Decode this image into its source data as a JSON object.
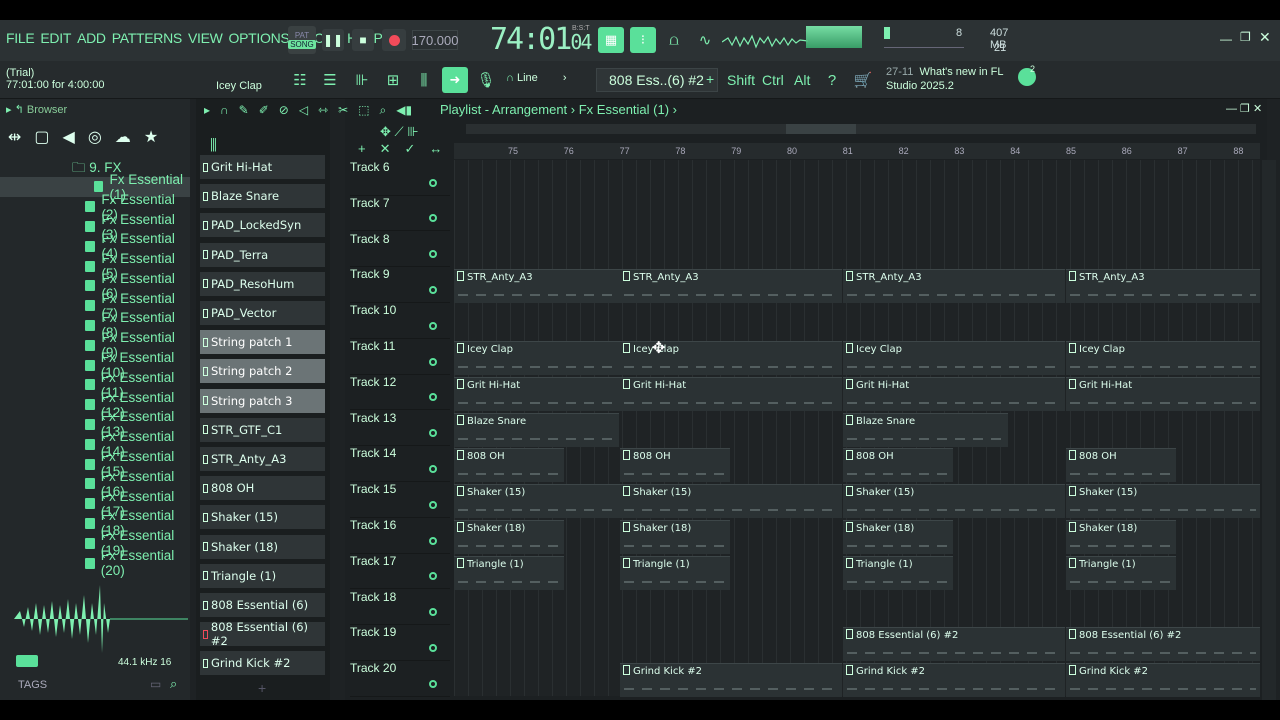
{
  "menu": [
    "FILE",
    "EDIT",
    "ADD",
    "PATTERNS",
    "VIEW",
    "OPTIONS",
    "TOOLS",
    "HELP"
  ],
  "transport": {
    "pat_label": "PAT",
    "song_label": "SONG",
    "tempo": "170.000",
    "time_main": "74:01",
    "time_sub": "04",
    "time_unit": "B:S:T"
  },
  "meters": {
    "voices": "8",
    "memory": "407 MB",
    "cpu": "21"
  },
  "hint": {
    "line1": "(Trial)",
    "line2": "77:01:00 for 4:00:00",
    "channel": "Icey Clap"
  },
  "toolbar": {
    "snap": "Line",
    "pattern": "808 Ess..(6) #2",
    "shift": "Shift",
    "ctrl": "Ctrl",
    "alt": "Alt"
  },
  "news": {
    "date": "27-11",
    "text1": "What's new in FL",
    "text2": "Studio 2025.2",
    "count": "2"
  },
  "browser": {
    "title": "Browser",
    "folder": "9. FX",
    "items": [
      "Fx Essential (1)",
      "Fx Essential (2)",
      "Fx Essential (3)",
      "Fx Essential (4)",
      "Fx Essential (5)",
      "Fx Essential (6)",
      "Fx Essential (7)",
      "Fx Essential (8)",
      "Fx Essential (9)",
      "Fx Essential (10)",
      "Fx Essential (11)",
      "Fx Essential (12)",
      "Fx Essential (13)",
      "Fx Essential (14)",
      "Fx Essential (15)",
      "Fx Essential (16)",
      "Fx Essential (17)",
      "Fx Essential (18)",
      "Fx Essential (19)",
      "Fx Essential (20)"
    ],
    "sample_rate": "44.1 kHz 16",
    "tags": "TAGS"
  },
  "channels": [
    "Grit Hi-Hat",
    "Blaze Snare",
    "PAD_LockedSyn",
    "PAD_Terra",
    "PAD_ResoHum",
    "PAD_Vector",
    "String patch 1",
    "String patch 2",
    "String patch 3",
    "STR_GTF_C1",
    "STR_Anty_A3",
    "808 OH",
    "Shaker (15)",
    "Shaker (18)",
    "Triangle (1)",
    "808 Essential (6)",
    "808 Essential (6) #2",
    "Grind Kick #2"
  ],
  "playlist": {
    "title": "Playlist - Arrangement",
    "pattern": "Fx Essential (1)",
    "bars": [
      "75",
      "76",
      "77",
      "78",
      "79",
      "80",
      "81",
      "82",
      "83",
      "84",
      "85",
      "86",
      "87",
      "88"
    ],
    "tracks": [
      "Track 6",
      "Track 7",
      "Track 8",
      "Track 9",
      "Track 10",
      "Track 11",
      "Track 12",
      "Track 13",
      "Track 14",
      "Track 15",
      "Track 16",
      "Track 17",
      "Track 18",
      "Track 19",
      "Track 20"
    ],
    "clips": [
      {
        "track": 3,
        "name": "STR_Anty_A3"
      },
      {
        "track": 5,
        "name": "Icey Clap"
      },
      {
        "track": 6,
        "name": "Grit Hi-Hat"
      },
      {
        "track": 7,
        "name": "Blaze Snare"
      },
      {
        "track": 8,
        "name": "808 OH"
      },
      {
        "track": 9,
        "name": "Shaker (15)"
      },
      {
        "track": 10,
        "name": "Shaker (18)"
      },
      {
        "track": 11,
        "name": "Triangle (1)"
      },
      {
        "track": 13,
        "name": "808 Essential (6) #2"
      },
      {
        "track": 14,
        "name": "Grind Kick #2"
      }
    ]
  }
}
